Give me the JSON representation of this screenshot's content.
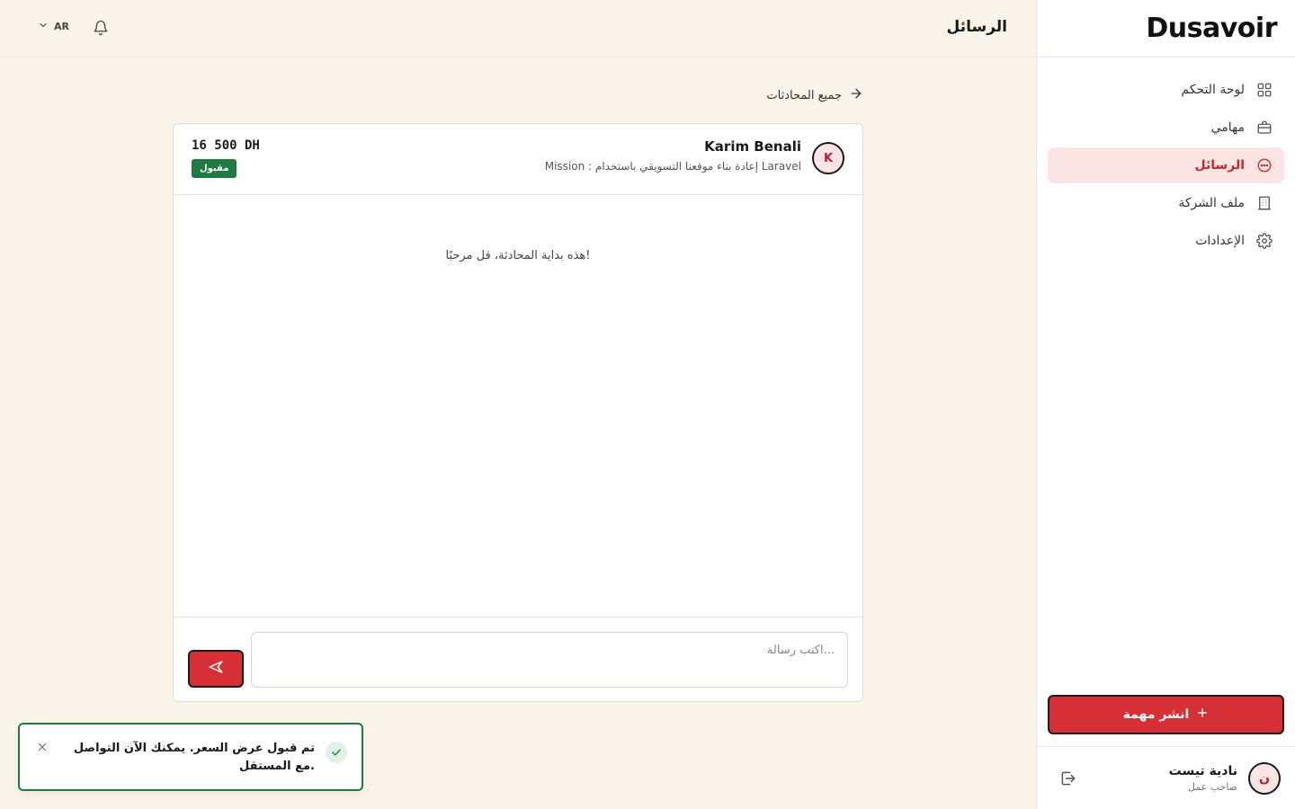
{
  "app": {
    "logo_text": "Dusavoir",
    "accent_color": "#d62f35",
    "success_color": "#1f7a42"
  },
  "sidebar": {
    "items": [
      {
        "label": "لوحة التحكم",
        "icon": "grid-icon",
        "active": false
      },
      {
        "label": "مهامي",
        "icon": "briefcase-icon",
        "active": false
      },
      {
        "label": "الرسائل",
        "icon": "message-icon",
        "active": true
      },
      {
        "label": "ملف الشركة",
        "icon": "building-icon",
        "active": false
      },
      {
        "label": "الإعدادات",
        "icon": "gear-icon",
        "active": false
      }
    ],
    "publish_label": "انشر مهمة",
    "user": {
      "initial": "ن",
      "name": "نادية تيست",
      "role": "صاحب عمل"
    }
  },
  "header": {
    "title": "الرسائل",
    "language": "AR"
  },
  "back_link": "جميع المحادثات",
  "chat": {
    "contact_initial": "K",
    "contact_name": "Karim Benali",
    "mission": "Mission : إعادة بناء موقعنا التسويقي باستخدام Laravel",
    "price": "16 500 DH",
    "status": "مقبول",
    "empty_message": "هذه بداية المحادثة، قل مرحبًا!",
    "input_placeholder": "اكتب رسالة..."
  },
  "toast": {
    "message": "تم قبول عرض السعر. يمكنك الآن التواصل مع المستقل."
  }
}
